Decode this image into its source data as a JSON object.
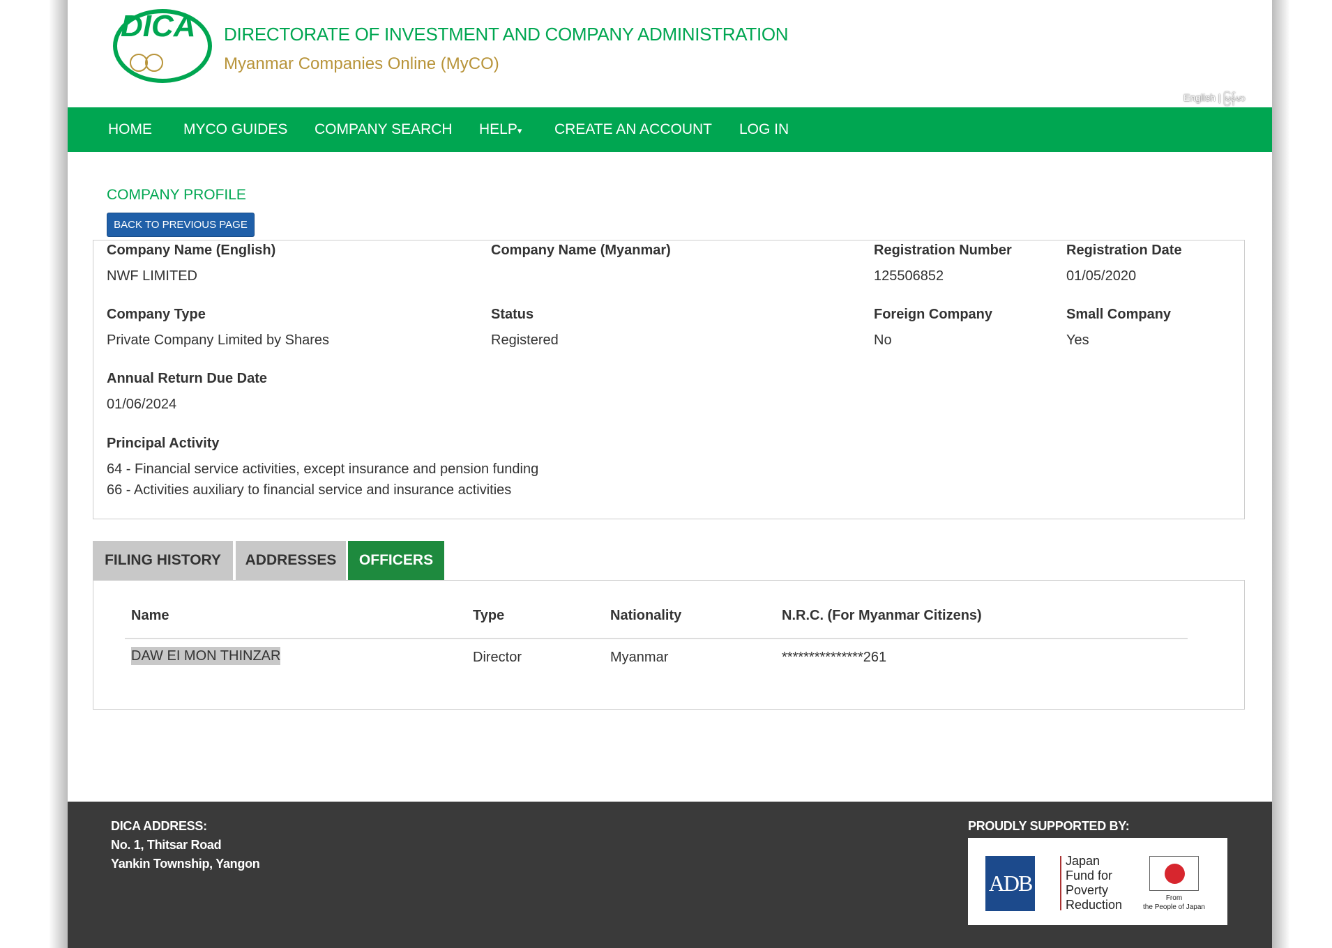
{
  "header": {
    "logo_text": "DICA",
    "title": "DIRECTORATE OF INVESTMENT AND COMPANY ADMINISTRATION",
    "subtitle": "Myanmar Companies Online (MyCO)",
    "lang_english": "English",
    "lang_separator": "|",
    "lang_myanmar": "မြန်မာ"
  },
  "nav": {
    "items": [
      "HOME",
      "MYCO GUIDES",
      "COMPANY SEARCH",
      "HELP",
      "CREATE AN ACCOUNT",
      "LOG IN"
    ],
    "help_caret": "▾"
  },
  "profile": {
    "heading": "COMPANY PROFILE",
    "back_button": "BACK TO PREVIOUS PAGE",
    "fields": {
      "name_en": {
        "label": "Company Name (English)",
        "value": "NWF LIMITED"
      },
      "name_mm": {
        "label": "Company Name (Myanmar)",
        "value": ""
      },
      "reg_no": {
        "label": "Registration Number",
        "value": "125506852"
      },
      "reg_date": {
        "label": "Registration Date",
        "value": "01/05/2020"
      },
      "type": {
        "label": "Company Type",
        "value": "Private Company Limited by Shares"
      },
      "status": {
        "label": "Status",
        "value": "Registered"
      },
      "foreign": {
        "label": "Foreign Company",
        "value": "No"
      },
      "small": {
        "label": "Small Company",
        "value": "Yes"
      },
      "annual": {
        "label": "Annual Return Due Date",
        "value": "01/06/2024"
      },
      "activity": {
        "label": "Principal Activity",
        "values": [
          "64 - Financial service activities, except insurance and pension funding",
          "66 - Activities auxiliary to financial service and insurance activities"
        ]
      }
    }
  },
  "tabs": [
    {
      "label": "FILING HISTORY"
    },
    {
      "label": "ADDRESSES"
    },
    {
      "label": "OFFICERS",
      "active": true
    }
  ],
  "officers": {
    "columns": [
      "Name",
      "Type",
      "Nationality",
      "N.R.C. (For Myanmar Citizens)"
    ],
    "rows": [
      {
        "name": "DAW EI MON THINZAR",
        "type": "Director",
        "nationality": "Myanmar",
        "nrc": "***************261"
      }
    ]
  },
  "footer": {
    "address_title": "DICA ADDRESS:",
    "address_lines": [
      "No. 1, Thitsar Road",
      "Yankin Township, Yangon"
    ],
    "supported_title": "PROUDLY SUPPORTED BY:",
    "sponsors": {
      "adb": "ADB",
      "jfpr": [
        "Japan",
        "Fund for",
        "Poverty",
        "Reduction"
      ],
      "japan": [
        "From",
        "the People of Japan"
      ]
    }
  },
  "colors": {
    "brand_green": "#00a651",
    "gold": "#b8943a",
    "button_blue": "#1f5fa8",
    "active_tab": "#1e8a3e",
    "footer_bg": "#3a3a3a",
    "adb_blue": "#1c4a8c",
    "japan_red": "#d7262e"
  }
}
